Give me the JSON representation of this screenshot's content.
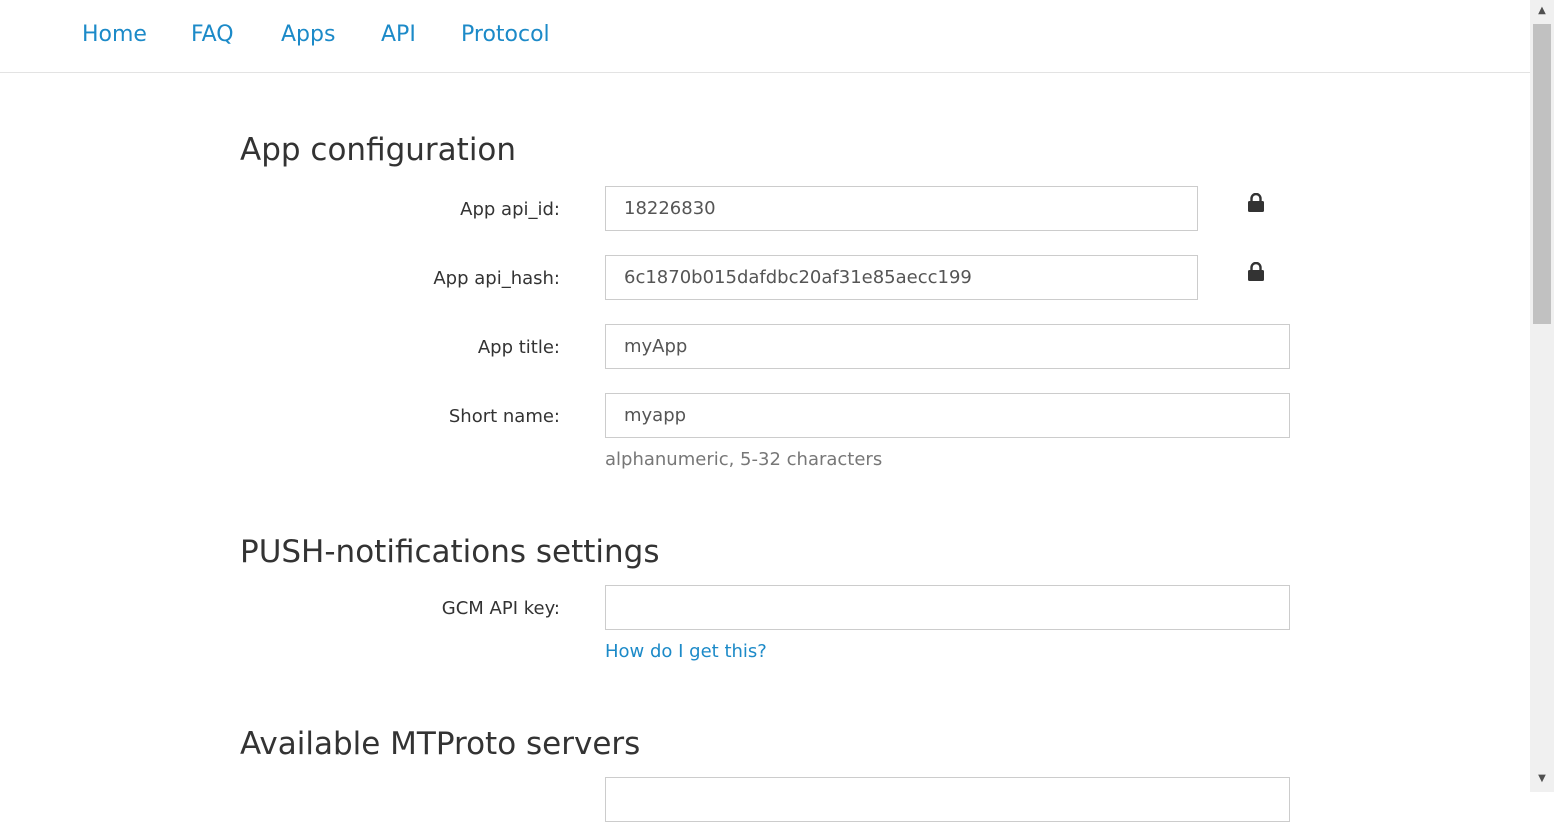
{
  "nav": {
    "items": [
      {
        "label": "Home"
      },
      {
        "label": "FAQ"
      },
      {
        "label": "Apps"
      },
      {
        "label": "API"
      },
      {
        "label": "Protocol"
      }
    ]
  },
  "app_config": {
    "title": "App configuration",
    "api_id": {
      "label": "App api_id:",
      "value": "18226830",
      "icon": "lock-icon"
    },
    "api_hash": {
      "label": "App api_hash:",
      "value": "6c1870b015dafdbc20af31e85aecc199",
      "icon": "lock-icon"
    },
    "app_title": {
      "label": "App title:",
      "value": "myApp"
    },
    "short_name": {
      "label": "Short name:",
      "value": "myapp",
      "help": "alphanumeric, 5-32 characters"
    }
  },
  "push": {
    "title": "PUSH-notifications settings",
    "gcm": {
      "label": "GCM API key:",
      "value": "",
      "help_link": "How do I get this?"
    }
  },
  "mtproto": {
    "title": "Available MTProto servers"
  },
  "colors": {
    "link": "#1c8ac8",
    "text": "#333333",
    "border": "#cccccc"
  }
}
